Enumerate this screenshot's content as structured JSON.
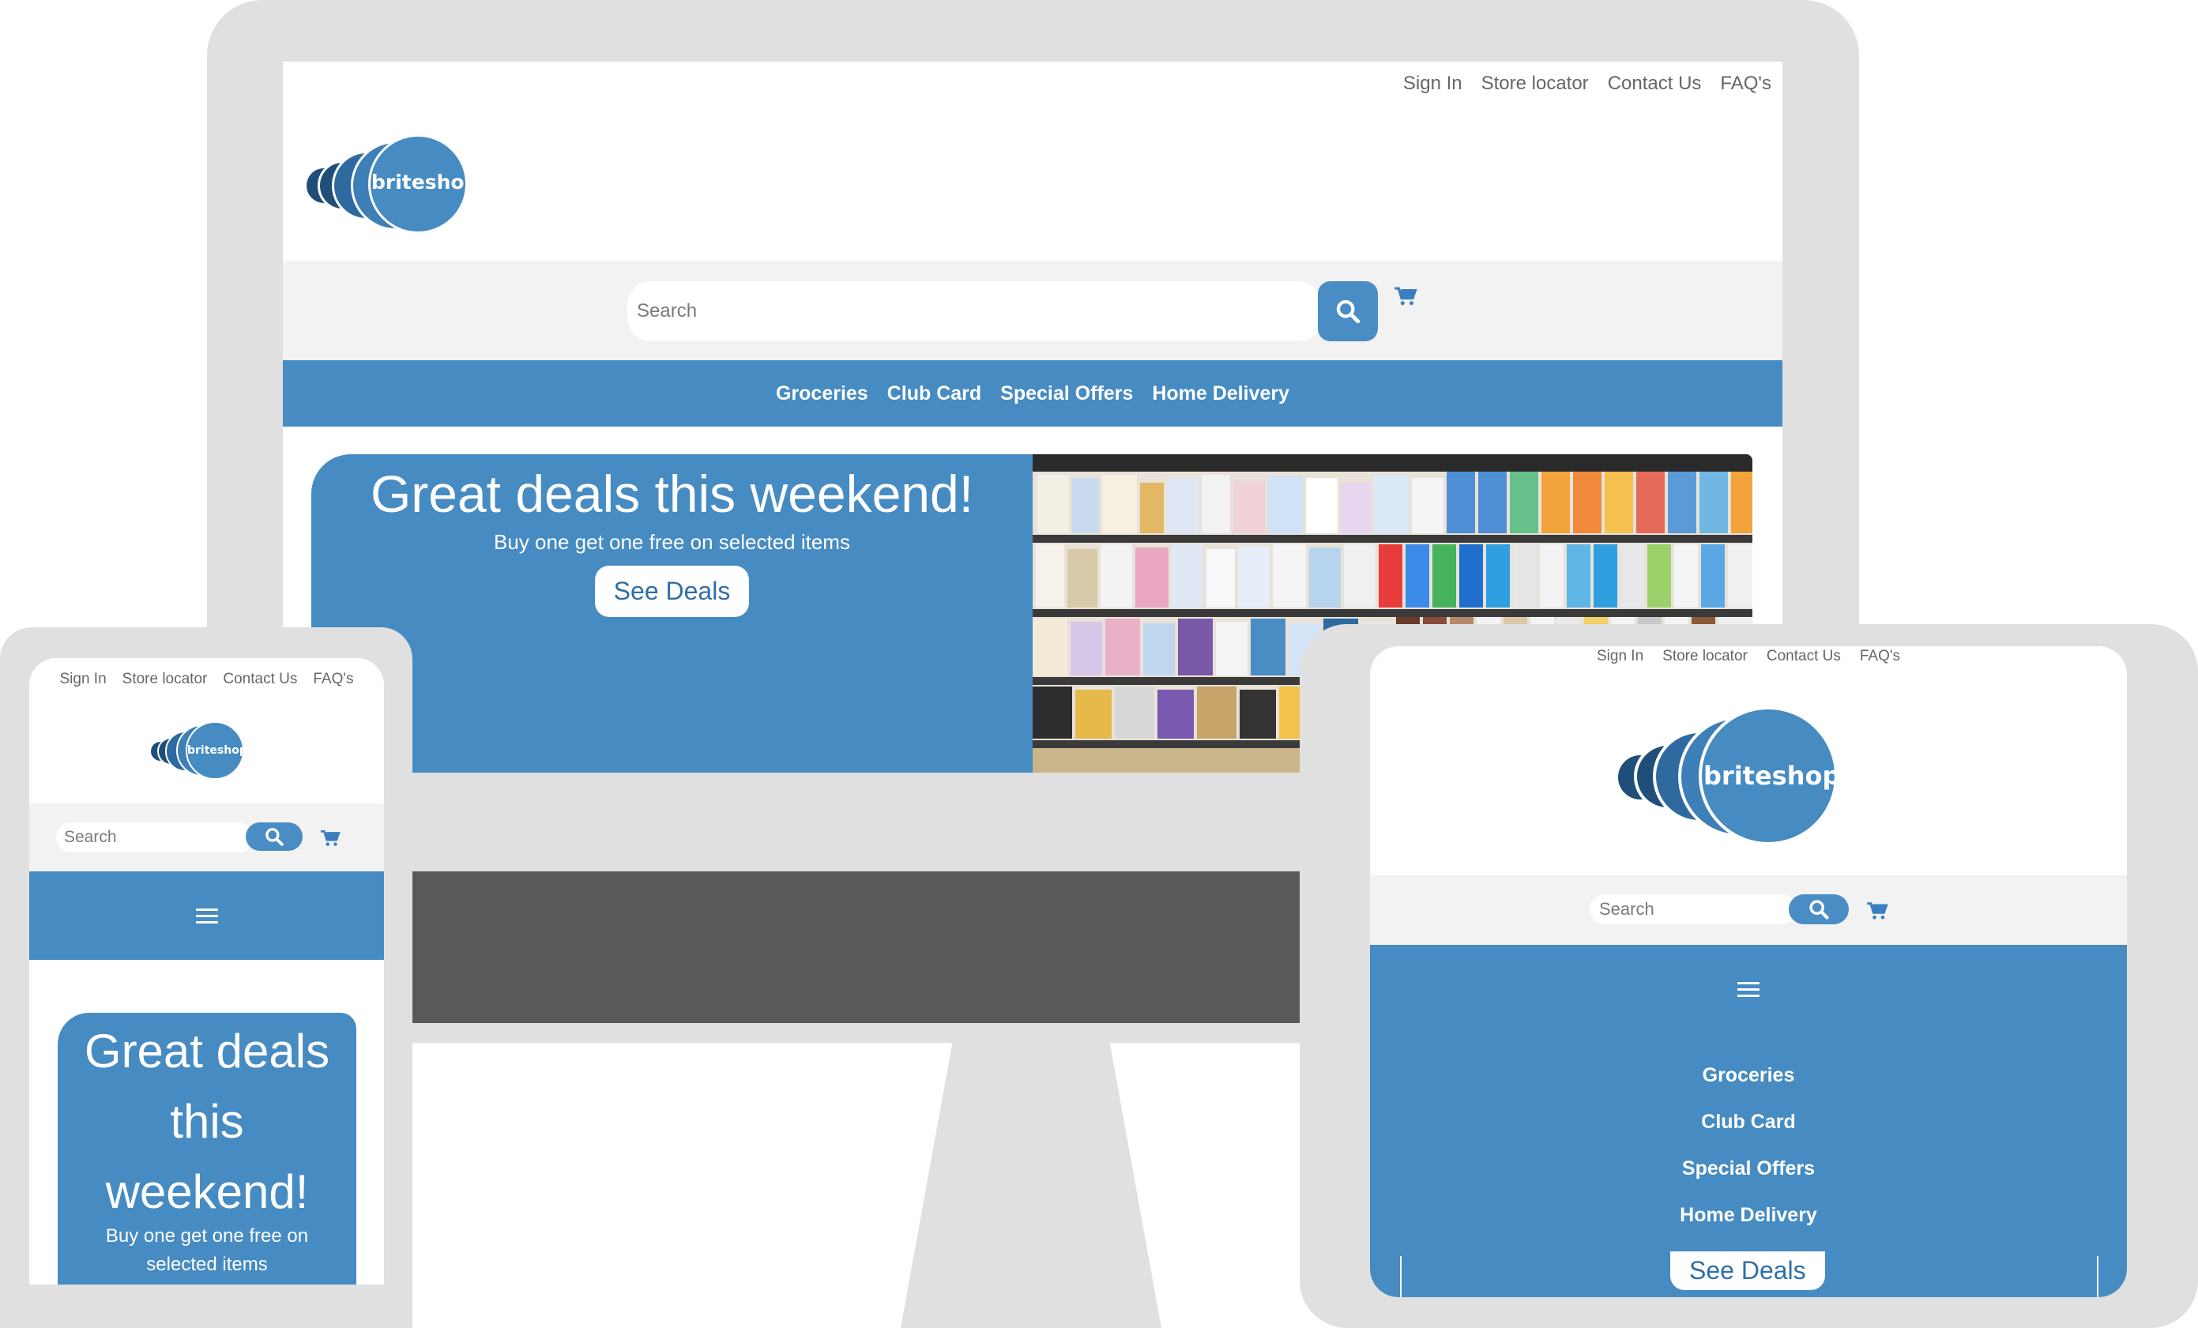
{
  "top_links": [
    "Sign In",
    "Store locator",
    "Contact Us",
    "FAQ's"
  ],
  "brand": {
    "name": "briteshop",
    "color": "#468bc2",
    "dark_color": "#1f4e79"
  },
  "search": {
    "placeholder": "Search"
  },
  "nav_items": [
    "Groceries",
    "Club Card",
    "Special Offers",
    "Home Delivery"
  ],
  "hero": {
    "title": "Great deals this weekend!",
    "subtitle": "Buy one get one free on selected items",
    "cta": "See Deals"
  },
  "phone": {
    "title_lines": [
      "Great deals",
      "this",
      "weekend!"
    ],
    "subtitle_lines": [
      "Buy one get one free on",
      "selected items"
    ]
  },
  "icons": {
    "search": "search-icon",
    "cart": "cart-icon",
    "menu": "hamburger-menu-icon"
  },
  "colors": {
    "accent": "#468bc2",
    "frame": "#e0e0e0",
    "searchbar_bg": "#f2f2f2",
    "monitor_chin": "#595959"
  }
}
